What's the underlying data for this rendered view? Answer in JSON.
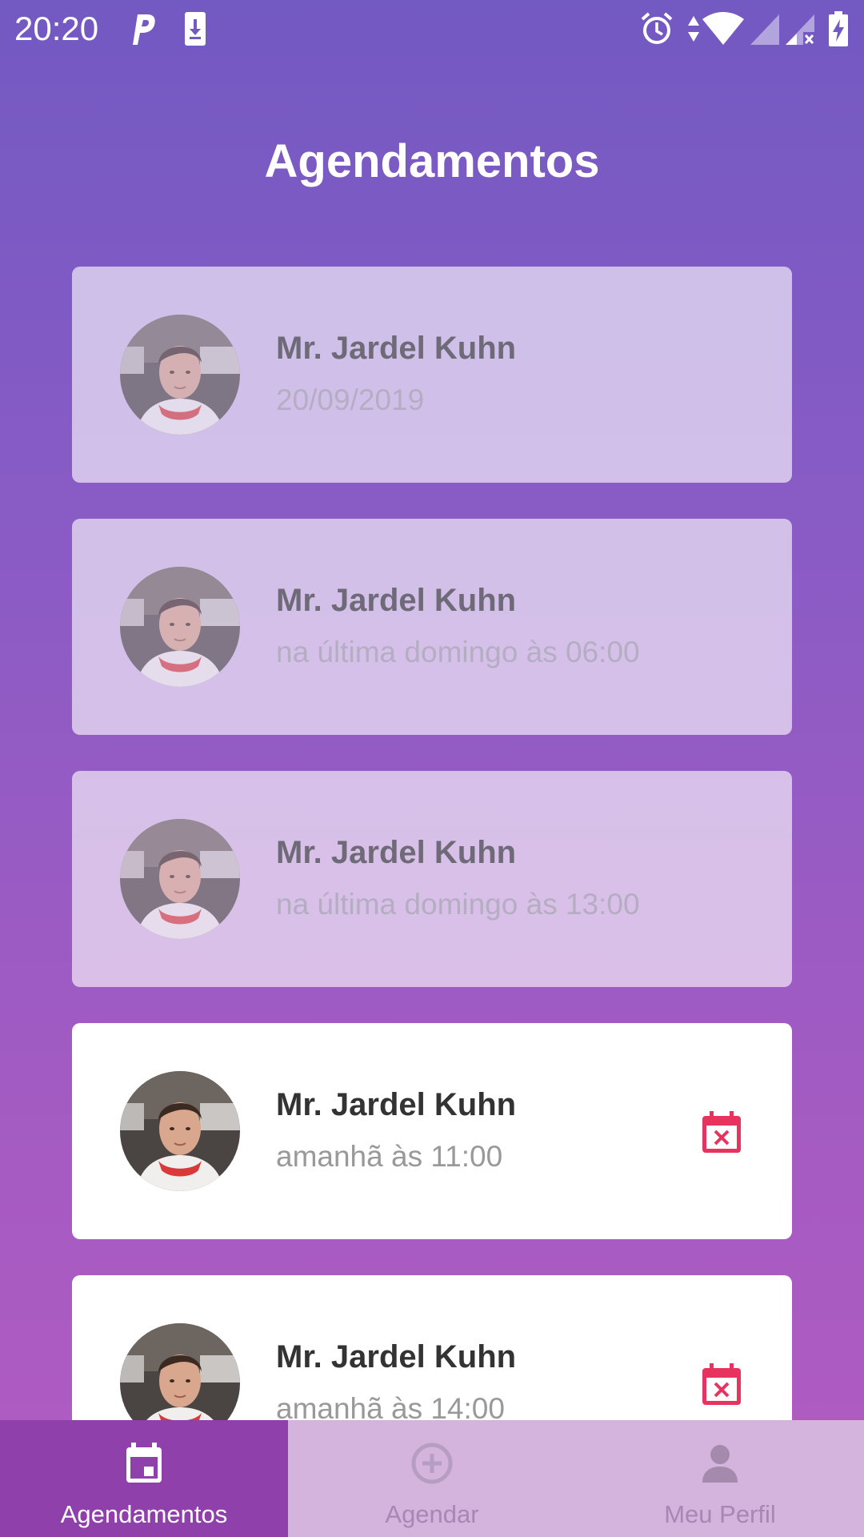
{
  "status_bar": {
    "time": "20:20",
    "icons": [
      "parking-icon",
      "download-icon",
      "alarm-icon",
      "data-arrows-icon",
      "wifi-icon",
      "signal-icon",
      "signal-x-icon",
      "battery-charging-icon"
    ]
  },
  "page": {
    "title": "Agendamentos"
  },
  "appointments": [
    {
      "name": "Mr. Jardel Kuhn",
      "when": "20/09/2019",
      "past": true
    },
    {
      "name": "Mr. Jardel Kuhn",
      "when": "na última domingo às 06:00",
      "past": true
    },
    {
      "name": "Mr. Jardel Kuhn",
      "when": "na última domingo às 13:00",
      "past": true
    },
    {
      "name": "Mr. Jardel Kuhn",
      "when": "amanhã às 11:00",
      "past": false,
      "action_icon": "calendar-cancel-icon"
    },
    {
      "name": "Mr. Jardel Kuhn",
      "when": "amanhã às 14:00",
      "past": false,
      "action_icon": "calendar-cancel-icon"
    }
  ],
  "tabs": [
    {
      "label": "Agendamentos",
      "icon": "calendar-icon",
      "active": true
    },
    {
      "label": "Agendar",
      "icon": "add-circle-icon",
      "active": false
    },
    {
      "label": "Meu Perfil",
      "icon": "person-icon",
      "active": false
    }
  ],
  "colors": {
    "accent": "#e8335e",
    "tab_active": "#8f40ab",
    "tab_bar": "#d4b3dd",
    "gradient_top": "#7359c2",
    "gradient_bottom": "#b25bc2"
  }
}
